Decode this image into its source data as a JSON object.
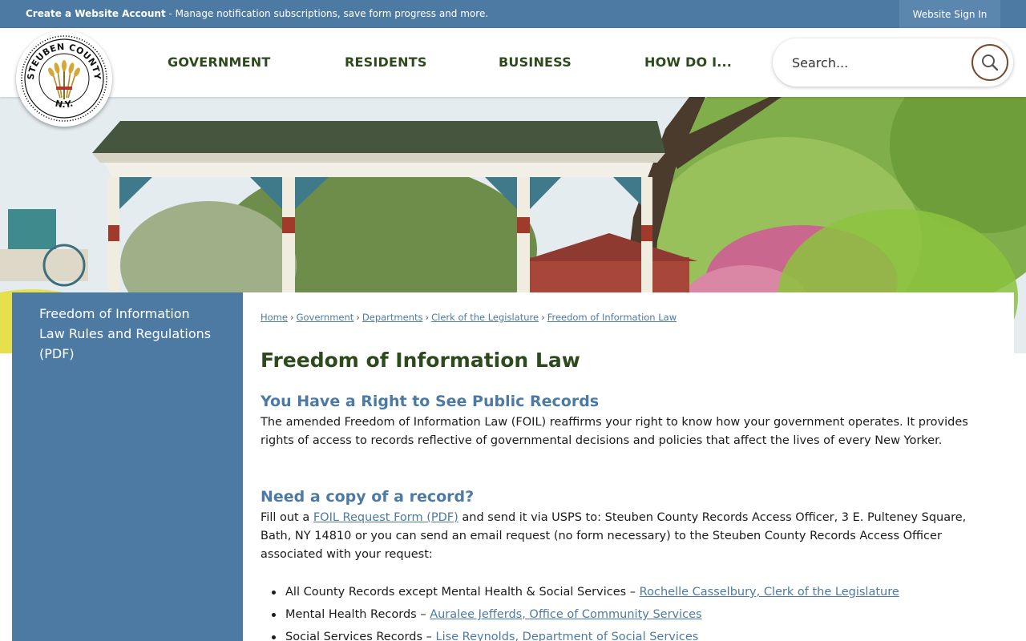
{
  "topbar": {
    "account_link": "Create a Website Account",
    "account_text": " - Manage notification subscriptions, save form progress and more.",
    "signin": "Website Sign In"
  },
  "header": {
    "seal_top_text": "STEUBEN COUNTY",
    "seal_bottom_text": "N.Y.",
    "nav": [
      "GOVERNMENT",
      "RESIDENTS",
      "BUSINESS",
      "HOW DO I..."
    ],
    "search_placeholder": "Search...",
    "search_icon": "search-icon"
  },
  "sidebar": {
    "items": [
      "Freedom of Information Law Rules and Regulations (PDF)"
    ]
  },
  "breadcrumb": [
    "Home",
    "Government",
    "Departments",
    "Clerk of the Legislature",
    "Freedom of Information Law"
  ],
  "main": {
    "title": "Freedom of Information Law",
    "section1": {
      "heading": "You Have a Right to See Public Records",
      "body": "The amended Freedom of Information Law (FOIL) reaffirms your right to know how your government operates. It provides rights of access to records reflective of governmental decisions and policies that affect the lives of every New Yorker."
    },
    "section2": {
      "heading": "Need a copy of a record?",
      "body_before": "Fill out a ",
      "form_link": "FOIL Request Form (PDF)",
      "body_after": " and send it via USPS to: Steuben County Records Access Officer, 3 E. Pulteney Square, Bath, NY 14810 or you can send an email request (no form necessary) to the Steuben County Records Access Officer associated with your request:"
    },
    "list": [
      {
        "text": "All County Records except Mental Health & Social Services – ",
        "link": "Rochelle Casselbury, Clerk of the Legislature"
      },
      {
        "text": "Mental Health Records – ",
        "link": "Auralee Jefferds, Office of Community Services"
      },
      {
        "text": "Social Services Records – ",
        "link": "Lise Reynolds, Department of Social Services"
      }
    ]
  },
  "colors": {
    "brand_blue": "#4d7aa3",
    "heading_green": "#2d4a1d",
    "search_ring": "#7a4a2e"
  }
}
